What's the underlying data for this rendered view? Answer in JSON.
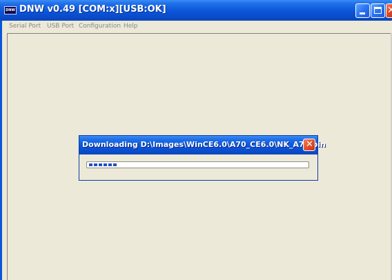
{
  "window": {
    "title": "DNW v0.49  [COM:x][USB:OK]",
    "icon_label": "DNW",
    "controls": {
      "minimize": "_",
      "maximize": "□",
      "close": "✕"
    }
  },
  "menubar": {
    "items": [
      {
        "label": "Serial Port"
      },
      {
        "label": "USB Port"
      },
      {
        "label": "Configuration"
      },
      {
        "label": "Help"
      }
    ]
  },
  "dialog": {
    "title": "Downloading D:\\Images\\WinCE6.0\\A70_CE6.0\\NK_A70.bin",
    "close_label": "✕",
    "progress_fraction": 0.13
  },
  "colors": {
    "titlebar": "#0b55d9",
    "window_bg": "#ece9d8",
    "progress_block": "#1f4fc0",
    "close_button": "#e04a20"
  },
  "icons": [
    "app-icon",
    "minimize-icon",
    "maximize-icon",
    "close-icon"
  ]
}
